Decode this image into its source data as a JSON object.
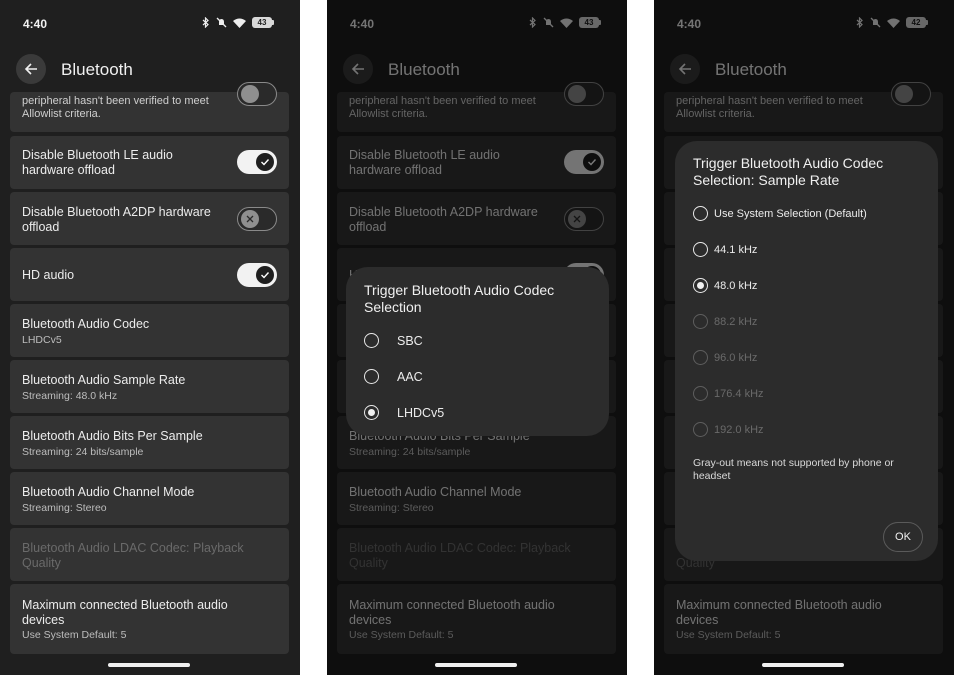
{
  "status_bar": {
    "time": "4:40",
    "battery_1": "43",
    "battery_2": "43",
    "battery_3": "42"
  },
  "app_bar": {
    "title": "Bluetooth"
  },
  "settings": {
    "partial_item": {
      "subtitle_line1": "peripheral hasn't been verified to meet",
      "subtitle_line2": "Allowlist criteria."
    },
    "le_audio_offload": {
      "title_line1": "Disable Bluetooth LE audio",
      "title_line2": "hardware offload",
      "state": "on"
    },
    "a2dp_offload": {
      "title_line1": "Disable Bluetooth A2DP hardware",
      "title_line2": "offload",
      "state": "off"
    },
    "hd_audio": {
      "title": "HD audio",
      "state": "on"
    },
    "codec": {
      "title": "Bluetooth Audio Codec",
      "subtitle": "LHDCv5"
    },
    "sample_rate": {
      "title": "Bluetooth Audio Sample Rate",
      "subtitle": "Streaming: 48.0 kHz"
    },
    "bits_per_sample": {
      "title": "Bluetooth Audio Bits Per Sample",
      "subtitle": "Streaming: 24 bits/sample"
    },
    "channel_mode": {
      "title": "Bluetooth Audio Channel Mode",
      "subtitle": "Streaming: Stereo"
    },
    "ldac_quality": {
      "title_line1": "Bluetooth Audio LDAC Codec: Playback",
      "title_line2": "Quality"
    },
    "max_devices": {
      "title_line1": "Maximum connected Bluetooth audio",
      "title_line2": "devices",
      "subtitle": "Use System Default: 5"
    }
  },
  "codec_dialog": {
    "title_line1": "Trigger Bluetooth Audio Codec",
    "title_line2": "Selection",
    "options": [
      {
        "label": "SBC",
        "selected": false
      },
      {
        "label": "AAC",
        "selected": false
      },
      {
        "label": "LHDCv5",
        "selected": true
      }
    ]
  },
  "sample_rate_dialog": {
    "title_line1": "Trigger Bluetooth Audio Codec",
    "title_line2": "Selection: Sample Rate",
    "options": [
      {
        "label": "Use System Selection (Default)",
        "selected": false,
        "enabled": true
      },
      {
        "label": "44.1 kHz",
        "selected": false,
        "enabled": true
      },
      {
        "label": "48.0 kHz",
        "selected": true,
        "enabled": true
      },
      {
        "label": "88.2 kHz",
        "selected": false,
        "enabled": false
      },
      {
        "label": "96.0 kHz",
        "selected": false,
        "enabled": false
      },
      {
        "label": "176.4 kHz",
        "selected": false,
        "enabled": false
      },
      {
        "label": "192.0 kHz",
        "selected": false,
        "enabled": false
      }
    ],
    "note": "Gray-out means not supported by phone or headset",
    "ok_label": "OK"
  },
  "colors": {
    "background": "#1f1f1f",
    "card": "#333333",
    "dialog": "#2c2c2c",
    "text": "#ececec",
    "disabled_text": "#6a6a6a"
  }
}
